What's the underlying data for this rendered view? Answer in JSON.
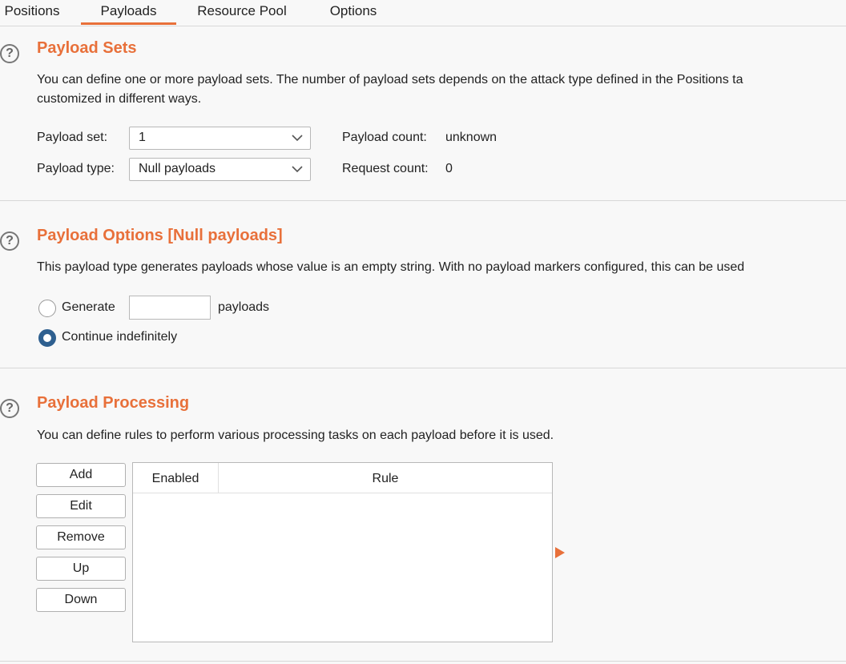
{
  "tabs": [
    {
      "label": "Positions",
      "active": false
    },
    {
      "label": "Payloads",
      "active": true
    },
    {
      "label": "Resource Pool",
      "active": false
    },
    {
      "label": "Options",
      "active": false
    }
  ],
  "accent_color": "#e8703a",
  "payload_sets": {
    "title": "Payload Sets",
    "description_line1": "You can define one or more payload sets. The number of payload sets depends on the attack type defined in the Positions ta",
    "description_line2": "customized in different ways.",
    "payload_set_label": "Payload set:",
    "payload_set_value": "1",
    "payload_type_label": "Payload type:",
    "payload_type_value": "Null payloads",
    "payload_count_label": "Payload count:",
    "payload_count_value": "unknown",
    "request_count_label": "Request count:",
    "request_count_value": "0"
  },
  "payload_options": {
    "title": "Payload Options [Null payloads]",
    "description": "This payload type generates payloads whose value is an empty string. With no payload markers configured, this can be used",
    "generate_label": "Generate",
    "generate_value": "",
    "payloads_suffix": "payloads",
    "continue_label": "Continue indefinitely",
    "selected_option": "Continue indefinitely"
  },
  "payload_processing": {
    "title": "Payload Processing",
    "description": "You can define rules to perform various processing tasks on each payload before it is used.",
    "buttons": [
      "Add",
      "Edit",
      "Remove",
      "Up",
      "Down"
    ],
    "columns": [
      "Enabled",
      "Rule"
    ],
    "rows": []
  },
  "help_icon_glyph": "?"
}
